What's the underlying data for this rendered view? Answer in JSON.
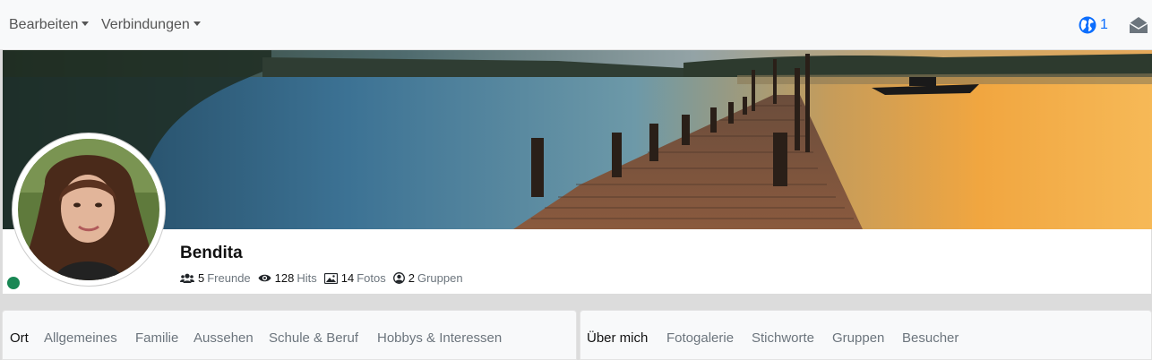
{
  "navbar": {
    "menu_edit": "Bearbeiten",
    "menu_connections": "Verbindungen",
    "globe_count": "1",
    "icons": [
      "globe-icon",
      "envelope-icon"
    ],
    "accent_color": "#0d6efd"
  },
  "profile": {
    "name": "Bendita",
    "online": true,
    "online_color": "#198754",
    "stats": {
      "friends_count": "5",
      "friends_label": "Freunde",
      "hits_count": "128",
      "hits_label": "Hits",
      "photos_count": "14",
      "photos_label": "Fotos",
      "groups_count": "2",
      "groups_label": "Gruppen"
    }
  },
  "left_tabs": [
    {
      "label": "Ort",
      "active": true
    },
    {
      "label": "Allgemeines",
      "active": false
    },
    {
      "label": "Familie",
      "active": false
    },
    {
      "label": "Aussehen",
      "active": false
    },
    {
      "label": "Schule & Beruf",
      "active": false
    },
    {
      "label": "Hobbys & Interessen",
      "active": false
    }
  ],
  "right_tabs": [
    {
      "label": "Über mich",
      "active": true
    },
    {
      "label": "Fotogalerie",
      "active": false
    },
    {
      "label": "Stichworte",
      "active": false
    },
    {
      "label": "Gruppen",
      "active": false
    },
    {
      "label": "Besucher",
      "active": false
    }
  ]
}
